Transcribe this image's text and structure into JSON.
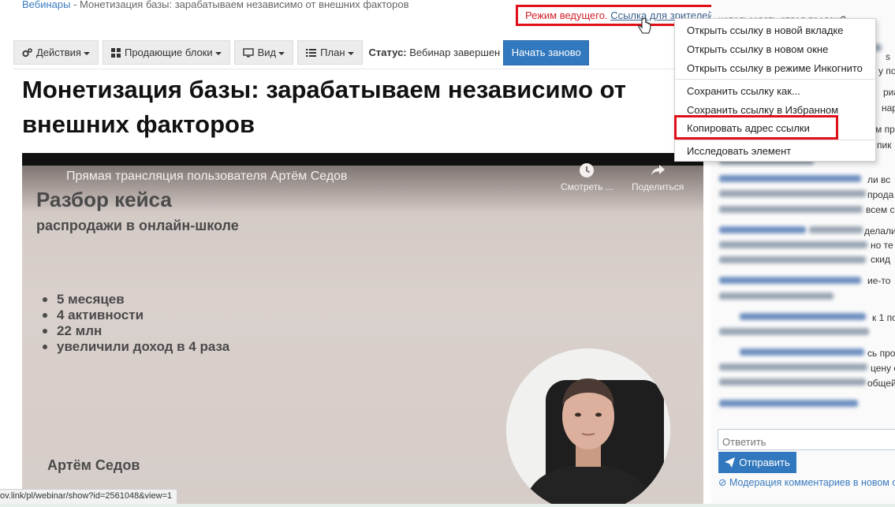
{
  "breadcrumb": {
    "root": "Вебинары",
    "separator": " - ",
    "current": "Монетизация базы: зарабатываем независимо от внешних факторов"
  },
  "host": {
    "mode": "Режим ведущего.",
    "viewer_link": "Ссылка для зрителей"
  },
  "toolbar": {
    "actions": "Действия",
    "blocks": "Продающие блоки",
    "view": "Вид",
    "plan": "План",
    "status_label": "Статус:",
    "status_value": "Вебинар завершен",
    "restart": "Начать заново"
  },
  "page_title": "Монетизация базы: зарабатываем независимо от внешних факторов",
  "video": {
    "stream_title": "Прямая трансляция пользователя Артём Седов",
    "watch_later": "Смотреть ...",
    "share": "Поделиться",
    "slide_title": "Разбор кейса",
    "slide_subtitle": "распродажи в онлайн-школе",
    "bullets": [
      "5 месяцев",
      "4 активности",
      "22 млн",
      "увеличили доход в 4 раза"
    ],
    "presenter": "Артём Седов"
  },
  "status_url": "ov.link/pl/webinar/show?id=2561048&view=1",
  "context_menu": {
    "items": [
      "Открыть ссылку в новой вкладке",
      "Открыть ссылку в новом окне",
      "Открыть ссылку в режиме Инкогнито",
      "Сохранить ссылку как...",
      "Сохранить ссылку в Избранном",
      "Копировать адрес ссылки",
      "Исследовать элемент"
    ]
  },
  "chat": {
    "top_fragment": "использовать отдел продаж?",
    "fragments": [
      "s",
      "y по",
      "риа",
      "нар",
      "м пр",
      "пик",
      "ли вс",
      "прода",
      "всем с",
      "делали",
      "но те",
      "скид",
      "ие-то",
      "к 1 по",
      "сь про",
      "цену с",
      "общей"
    ],
    "reply_placeholder": "Ответить",
    "send": "Отправить",
    "moderation": "Модерация комментариев в новом о"
  },
  "colors": {
    "accent_blue": "#3278be",
    "highlight_red": "#e0101a",
    "host_mode_red": "#d0212a",
    "link_blue": "#3a7bbf"
  }
}
